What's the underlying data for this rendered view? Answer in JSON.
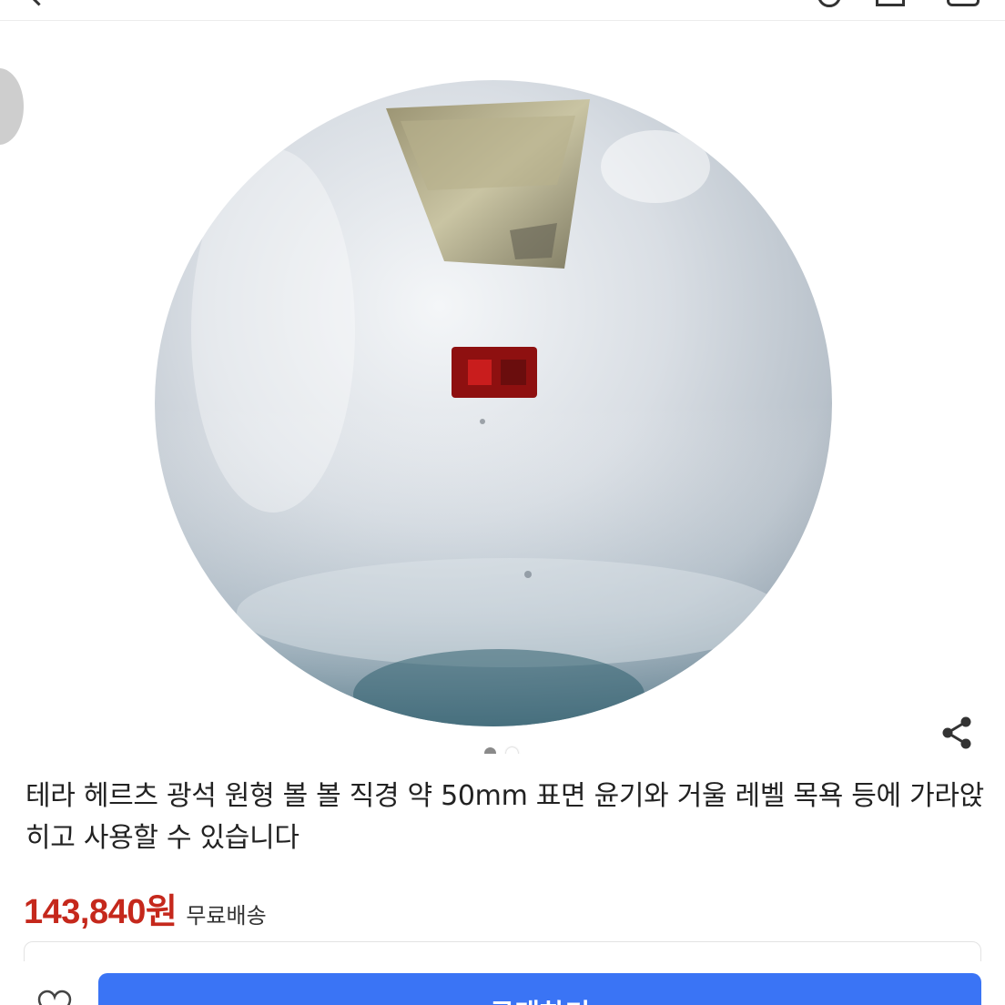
{
  "top_bar": {
    "back_icon": "back-arrow-icon",
    "search_icon": "search-icon",
    "home_icon": "home-icon",
    "cart_icon": "cart-icon"
  },
  "gallery": {
    "image_description_icon": "product-photo",
    "page_indicator": {
      "current": 1,
      "total": 2
    },
    "share_icon": "share-icon",
    "prev_icon": "prev-arrow-icon"
  },
  "product": {
    "title": "테라 헤르츠 광석 원형 볼 볼 직경 약 50mm 표면 윤기와 거울 레벨 목욕 등에 가라앉히고 사용할 수 있습니다",
    "price": "143,840원",
    "shipping": "무료배송"
  },
  "bottom_bar": {
    "like_icon": "heart-icon",
    "buy_label": "구매하기"
  },
  "colors": {
    "price": "#c5281c",
    "buy_button": "#3a74f5",
    "text": "#222222"
  }
}
